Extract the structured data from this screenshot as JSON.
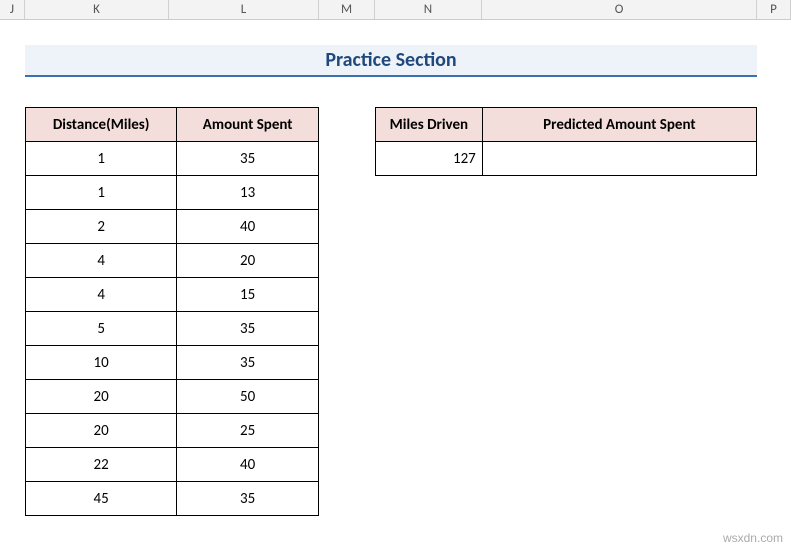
{
  "columns": {
    "J": "J",
    "K": "K",
    "L": "L",
    "M": "M",
    "N": "N",
    "O": "O",
    "P": "P"
  },
  "title": "Practice Section",
  "left_table": {
    "headers": {
      "distance": "Distance(Miles)",
      "amount": "Amount Spent"
    },
    "rows": [
      {
        "distance": "1",
        "amount": "35"
      },
      {
        "distance": "1",
        "amount": "13"
      },
      {
        "distance": "2",
        "amount": "40"
      },
      {
        "distance": "4",
        "amount": "20"
      },
      {
        "distance": "4",
        "amount": "15"
      },
      {
        "distance": "5",
        "amount": "35"
      },
      {
        "distance": "10",
        "amount": "35"
      },
      {
        "distance": "20",
        "amount": "50"
      },
      {
        "distance": "20",
        "amount": "25"
      },
      {
        "distance": "22",
        "amount": "40"
      },
      {
        "distance": "45",
        "amount": "35"
      }
    ]
  },
  "right_table": {
    "headers": {
      "miles": "Miles Driven",
      "predicted": "Predicted Amount Spent"
    },
    "rows": [
      {
        "miles": "127",
        "predicted": ""
      }
    ]
  },
  "watermark": "wsxdn.com"
}
